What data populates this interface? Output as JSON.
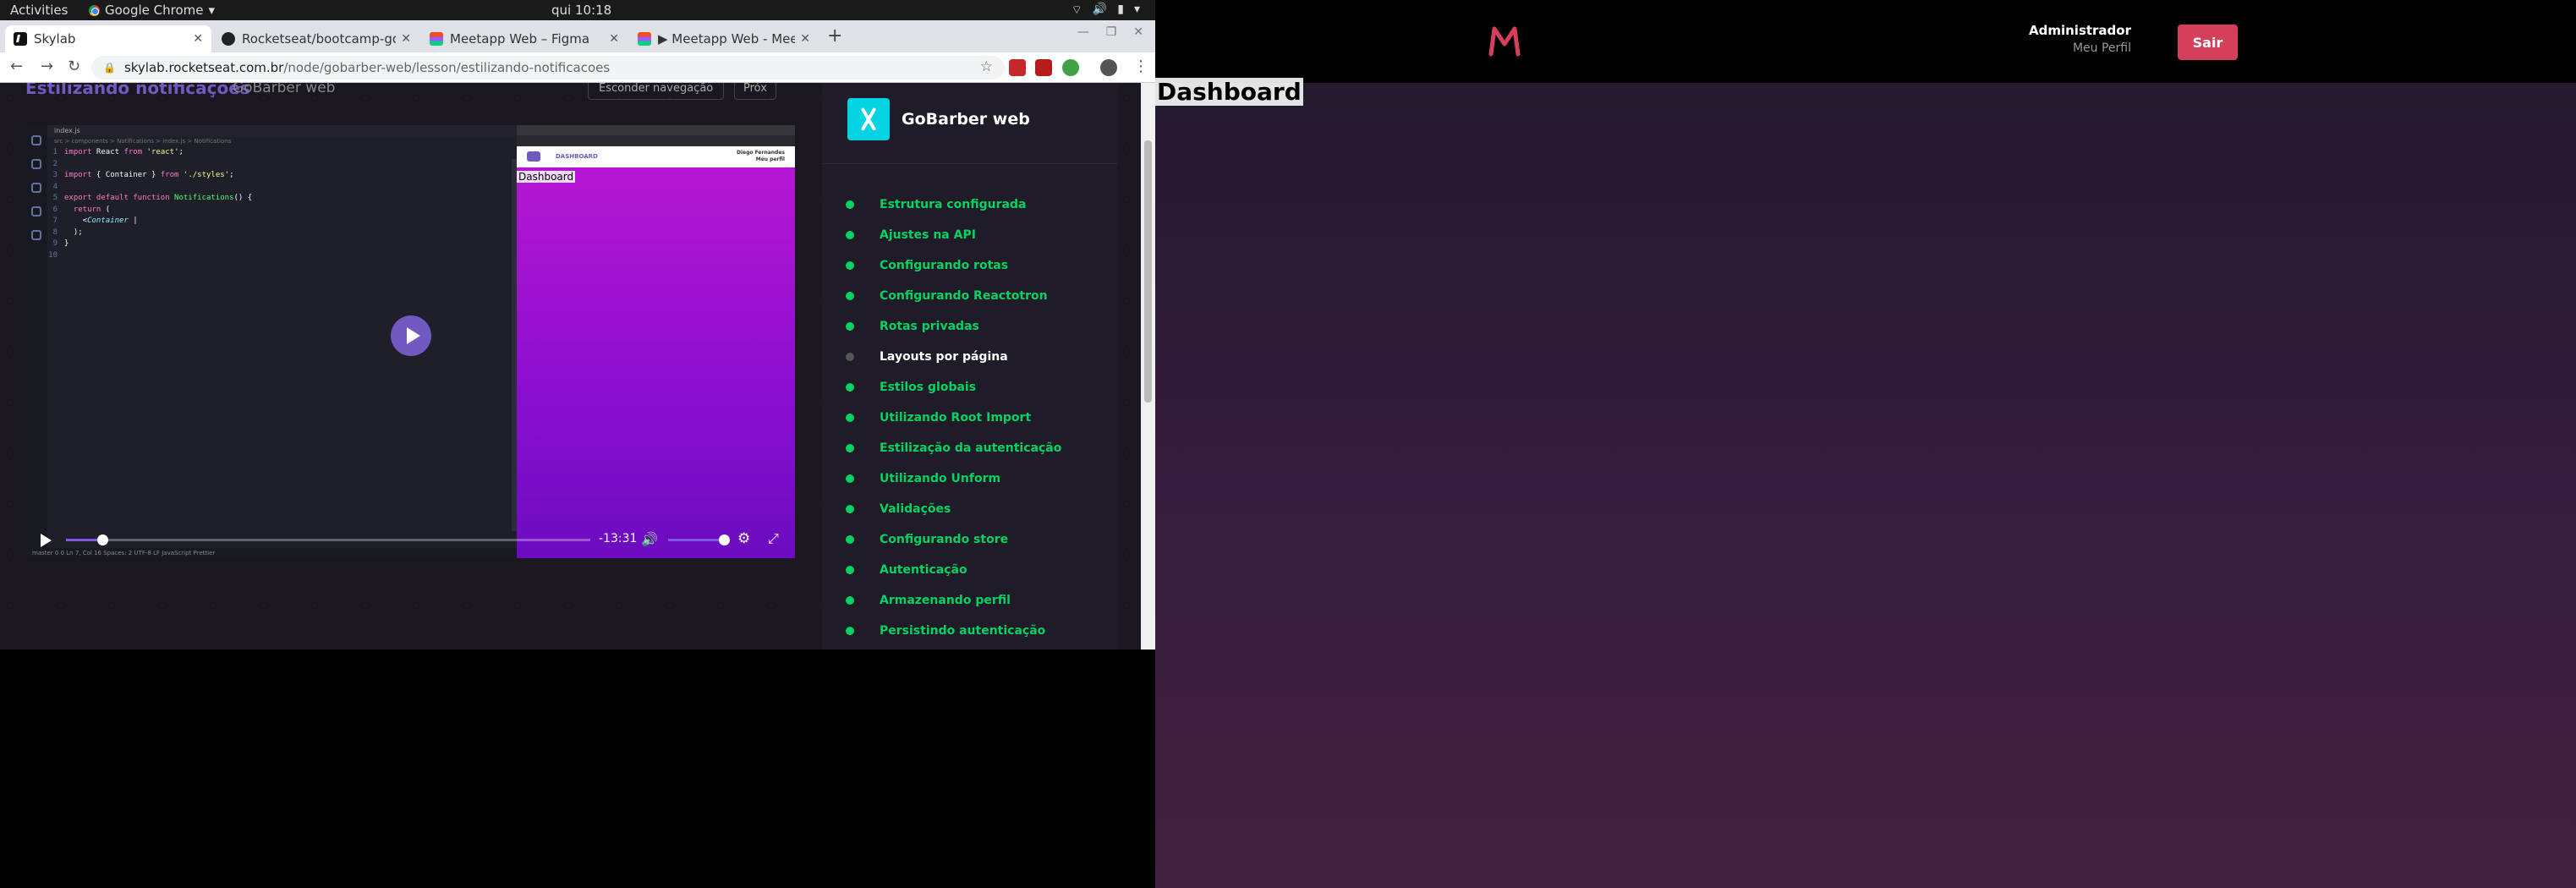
{
  "system": {
    "activities": "Activities",
    "app": "Google Chrome",
    "clock": "qui 10:18"
  },
  "tabs": [
    {
      "title": "Skylab"
    },
    {
      "title": "Rocketseat/bootcamp-go"
    },
    {
      "title": "Meetapp Web – Figma"
    },
    {
      "title": "▶ Meetapp Web - Meetap"
    }
  ],
  "url": {
    "host": "skylab.rocketseat.com.br",
    "path": "/node/gobarber-web/lesson/estilizando-notificacoes"
  },
  "lesson": {
    "title": "Estilizando notificações",
    "course": "GoBarber web",
    "hide_nav": "Esconder navegação",
    "next": "Próx"
  },
  "video": {
    "editor_tab": "index.js",
    "breadcrumb": "src > components > Notifications > index.js > Notifications",
    "code": [
      {
        "n": "1",
        "tokens": [
          [
            "k",
            "import"
          ],
          [
            "p",
            " React "
          ],
          [
            "k",
            "from"
          ],
          [
            "s",
            " 'react'"
          ],
          [
            "p",
            ";"
          ]
        ]
      },
      {
        "n": "2",
        "tokens": []
      },
      {
        "n": "3",
        "tokens": [
          [
            "k",
            "import"
          ],
          [
            "p",
            " { Container } "
          ],
          [
            "k",
            "from"
          ],
          [
            "s",
            " './styles'"
          ],
          [
            "p",
            ";"
          ]
        ]
      },
      {
        "n": "4",
        "tokens": []
      },
      {
        "n": "5",
        "tokens": [
          [
            "k",
            "export default function"
          ],
          [
            "f",
            " Notifications"
          ],
          [
            "p",
            "() {"
          ]
        ]
      },
      {
        "n": "6",
        "tokens": [
          [
            "k",
            "  return"
          ],
          [
            "p",
            " ("
          ]
        ]
      },
      {
        "n": "7",
        "tokens": [
          [
            "p",
            "    <"
          ],
          [
            "t",
            "Container"
          ],
          [
            "p",
            " |"
          ]
        ]
      },
      {
        "n": "8",
        "tokens": [
          [
            "p",
            "  );"
          ]
        ]
      },
      {
        "n": "9",
        "tokens": [
          [
            "p",
            "}"
          ]
        ]
      },
      {
        "n": "10",
        "tokens": []
      }
    ],
    "status": "master  0  0  Ln 7, Col 16  Spaces: 2  UTF-8  LF  JavaScript  Prettier",
    "mini_nav": "DASHBOARD",
    "mini_user": "Diego Fernandes",
    "mini_user_link": "Meu perfil",
    "mini_dashboard": "Dashboard",
    "time_remaining": "-13:31",
    "progress": 0.07,
    "volume": 1.0
  },
  "sidebar": {
    "title": "GoBarber web",
    "items": [
      {
        "label": "Estrutura configurada",
        "done": true
      },
      {
        "label": "Ajustes na API",
        "done": true
      },
      {
        "label": "Configurando rotas",
        "done": true
      },
      {
        "label": "Configurando Reactotron",
        "done": true
      },
      {
        "label": "Rotas privadas",
        "done": true
      },
      {
        "label": "Layouts por página",
        "done": false
      },
      {
        "label": "Estilos globais",
        "done": true
      },
      {
        "label": "Utilizando Root Import",
        "done": true
      },
      {
        "label": "Estilização da autenticação",
        "done": true
      },
      {
        "label": "Utilizando Unform",
        "done": true
      },
      {
        "label": "Validações",
        "done": true
      },
      {
        "label": "Configurando store",
        "done": true
      },
      {
        "label": "Autenticação",
        "done": true
      },
      {
        "label": "Armazenando perfil",
        "done": true
      },
      {
        "label": "Persistindo autenticação",
        "done": true
      }
    ]
  },
  "meetapp": {
    "user_name": "Administrador",
    "profile_link": "Meu Perfil",
    "logout": "Sair",
    "page_title": "Dashboard",
    "brand_color": "#d44059"
  }
}
